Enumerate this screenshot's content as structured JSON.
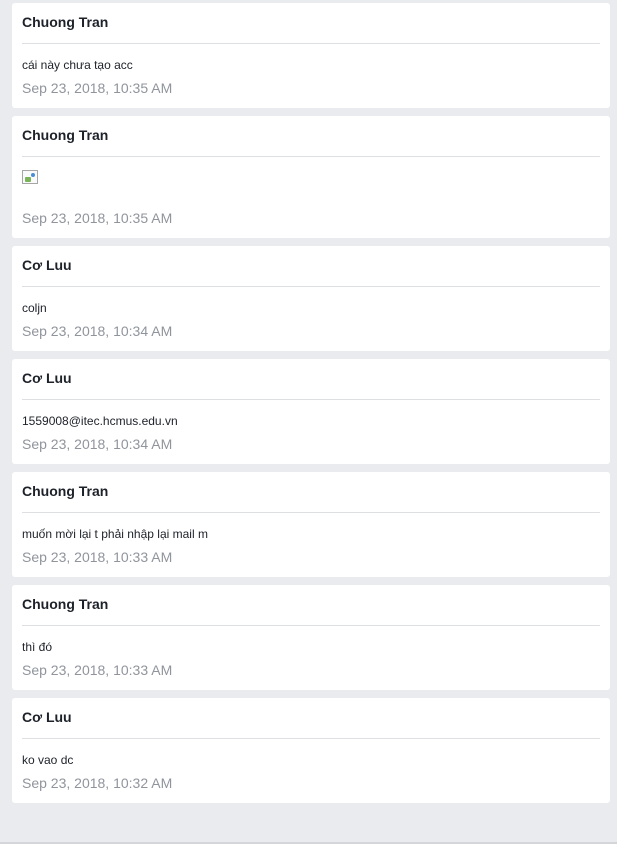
{
  "messages": [
    {
      "author": "Chuong Tran",
      "text": "cái này chưa tạo acc",
      "time": "Sep 23, 2018, 10:35 AM",
      "image": false
    },
    {
      "author": "Chuong Tran",
      "text": "",
      "time": "Sep 23, 2018, 10:35 AM",
      "image": true,
      "image_icon": "broken-image-icon"
    },
    {
      "author": "Cơ Luu",
      "text": "coljn",
      "time": "Sep 23, 2018, 10:34 AM",
      "image": false
    },
    {
      "author": "Cơ Luu",
      "text": "1559008@itec.hcmus.edu.vn",
      "time": "Sep 23, 2018, 10:34 AM",
      "image": false
    },
    {
      "author": "Chuong Tran",
      "text": "muốn mời lại t phải nhập lại mail m",
      "time": "Sep 23, 2018, 10:33 AM",
      "image": false
    },
    {
      "author": "Chuong Tran",
      "text": "thì đó",
      "time": "Sep 23, 2018, 10:33 AM",
      "image": false
    },
    {
      "author": "Cơ Luu",
      "text": "ko vao dc",
      "time": "Sep 23, 2018, 10:32 AM",
      "image": false
    }
  ],
  "colors": {
    "background": "#e9ebee",
    "card": "#ffffff",
    "author_text": "#1d2129",
    "timestamp_text": "#90949c",
    "divider": "#dddfe2"
  }
}
